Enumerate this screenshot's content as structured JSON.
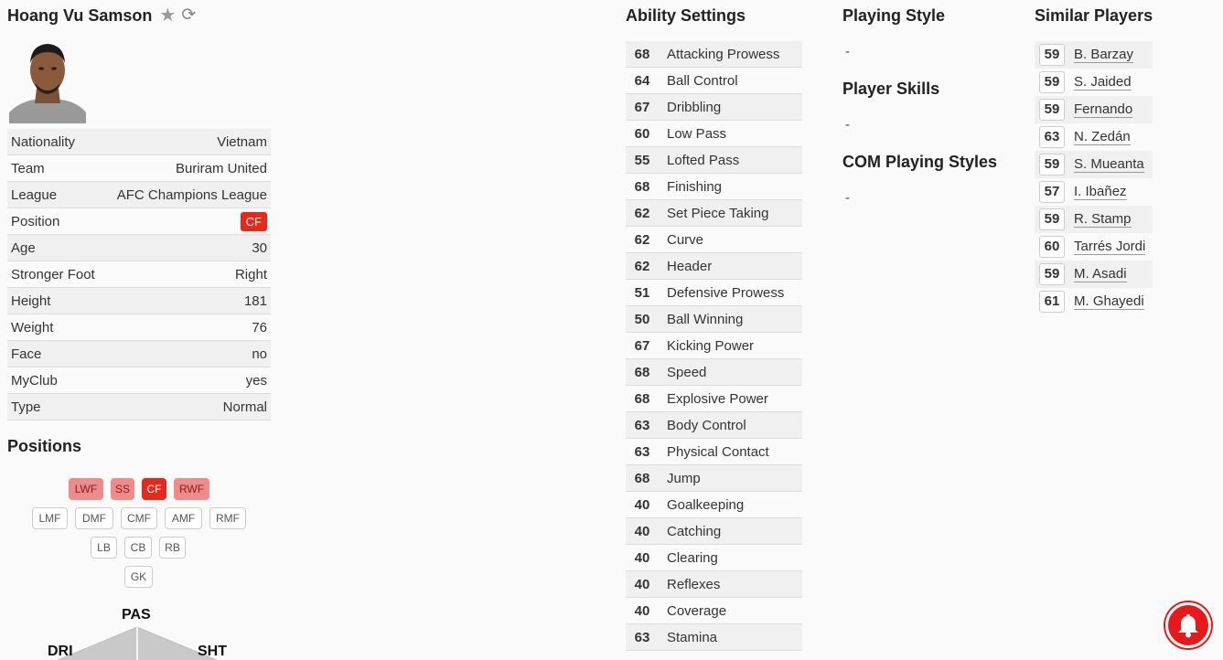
{
  "player": {
    "name": "Hoang Vu Samson",
    "favorite_icon": "star-icon",
    "refresh_icon": "refresh-icon"
  },
  "info": [
    {
      "label": "Nationality",
      "value": "Vietnam"
    },
    {
      "label": "Team",
      "value": "Buriram United"
    },
    {
      "label": "League",
      "value": "AFC Champions League"
    },
    {
      "label": "Position",
      "value": "CF"
    },
    {
      "label": "Age",
      "value": "30"
    },
    {
      "label": "Stronger Foot",
      "value": "Right"
    },
    {
      "label": "Height",
      "value": "181"
    },
    {
      "label": "Weight",
      "value": "76"
    },
    {
      "label": "Face",
      "value": "no"
    },
    {
      "label": "MyClub",
      "value": "yes"
    },
    {
      "label": "Type",
      "value": "Normal"
    }
  ],
  "positions": {
    "title": "Positions",
    "chips": {
      "lwf": "LWF",
      "ss": "SS",
      "cf": "CF",
      "rwf": "RWF",
      "lmf": "LMF",
      "dmf": "DMF",
      "cmf": "CMF",
      "amf": "AMF",
      "rmf": "RMF",
      "lb": "LB",
      "cb": "CB",
      "rb": "RB",
      "gk": "GK"
    }
  },
  "radar": {
    "pas": "PAS",
    "dri": "DRI",
    "sht": "SHT"
  },
  "ability": {
    "title": "Ability Settings",
    "rows": [
      {
        "value": "68",
        "name": "Attacking Prowess"
      },
      {
        "value": "64",
        "name": "Ball Control"
      },
      {
        "value": "67",
        "name": "Dribbling"
      },
      {
        "value": "60",
        "name": "Low Pass"
      },
      {
        "value": "55",
        "name": "Lofted Pass"
      },
      {
        "value": "68",
        "name": "Finishing"
      },
      {
        "value": "62",
        "name": "Set Piece Taking"
      },
      {
        "value": "62",
        "name": "Curve"
      },
      {
        "value": "62",
        "name": "Header"
      },
      {
        "value": "51",
        "name": "Defensive Prowess"
      },
      {
        "value": "50",
        "name": "Ball Winning"
      },
      {
        "value": "67",
        "name": "Kicking Power"
      },
      {
        "value": "68",
        "name": "Speed"
      },
      {
        "value": "68",
        "name": "Explosive Power"
      },
      {
        "value": "63",
        "name": "Body Control"
      },
      {
        "value": "63",
        "name": "Physical Contact"
      },
      {
        "value": "68",
        "name": "Jump"
      },
      {
        "value": "40",
        "name": "Goalkeeping"
      },
      {
        "value": "40",
        "name": "Catching"
      },
      {
        "value": "40",
        "name": "Clearing"
      },
      {
        "value": "40",
        "name": "Reflexes"
      },
      {
        "value": "40",
        "name": "Coverage"
      },
      {
        "value": "63",
        "name": "Stamina"
      }
    ]
  },
  "playing_style": {
    "title": "Playing Style",
    "value": "-"
  },
  "player_skills": {
    "title": "Player Skills",
    "value": "-"
  },
  "com_styles": {
    "title": "COM Playing Styles",
    "value": "-"
  },
  "similar": {
    "title": "Similar Players",
    "rows": [
      {
        "value": "59",
        "name": "B. Barzay"
      },
      {
        "value": "59",
        "name": "S. Jaided"
      },
      {
        "value": "59",
        "name": "Fernando"
      },
      {
        "value": "63",
        "name": "N. Zedán"
      },
      {
        "value": "59",
        "name": "S. Mueanta"
      },
      {
        "value": "57",
        "name": "I. Ibañez"
      },
      {
        "value": "59",
        "name": "R. Stamp"
      },
      {
        "value": "60",
        "name": "Tarrés Jordi"
      },
      {
        "value": "59",
        "name": "M. Asadi"
      },
      {
        "value": "61",
        "name": "M. Ghayedi"
      }
    ]
  },
  "colors": {
    "accent_red": "#e8281b",
    "hot_pink": "#ef8b8b",
    "bell_red": "#e8191b"
  }
}
